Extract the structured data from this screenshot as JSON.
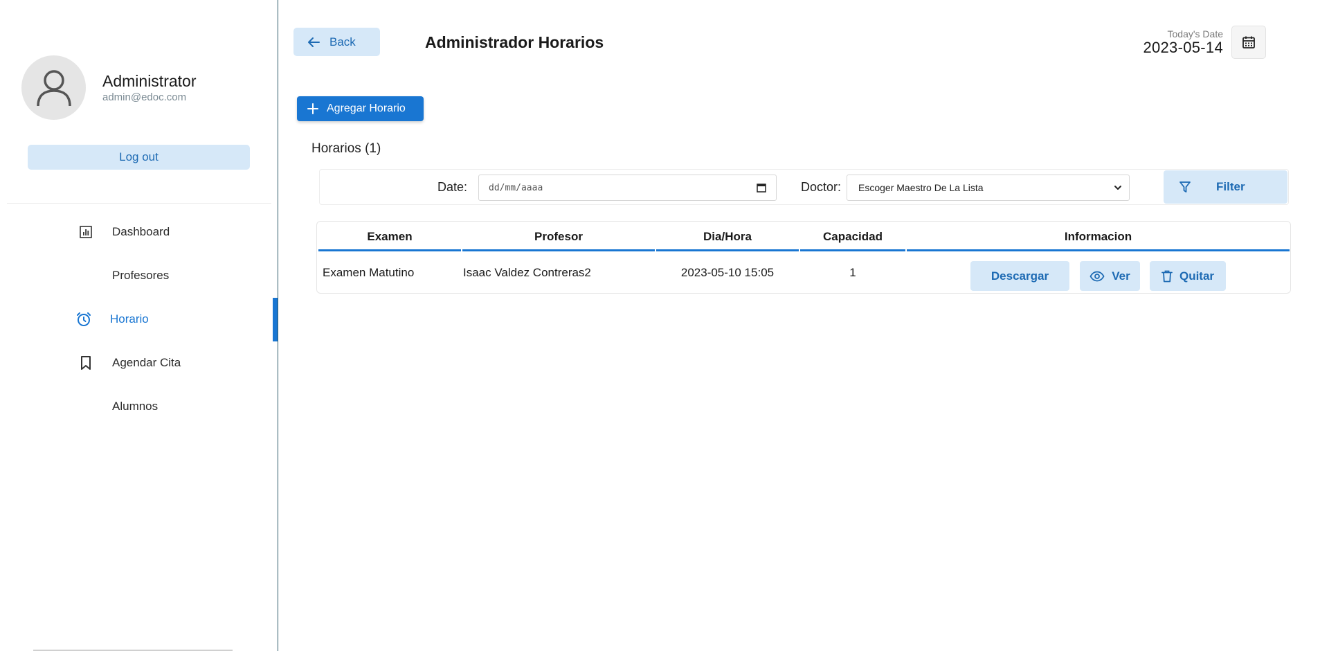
{
  "profile": {
    "name": "Administrator",
    "email": "admin@edoc.com",
    "logout_label": "Log out"
  },
  "sidebar": {
    "items": [
      {
        "label": "Dashboard",
        "icon": "dashboard-icon",
        "active": false
      },
      {
        "label": "Profesores",
        "icon": "",
        "active": false
      },
      {
        "label": "Horario",
        "icon": "alarm-clock-icon",
        "active": true
      },
      {
        "label": "Agendar Cita",
        "icon": "bookmark-icon",
        "active": false
      },
      {
        "label": "Alumnos",
        "icon": "",
        "active": false
      }
    ]
  },
  "header": {
    "back_label": "Back",
    "title": "Administrador Horarios",
    "today_label": "Today's Date",
    "today_value": "2023-05-14"
  },
  "actions": {
    "add_label": "Agregar Horario"
  },
  "section": {
    "title": "Horarios (1)"
  },
  "filter": {
    "date_label": "Date:",
    "date_placeholder": "dd/mm/aaaa",
    "doctor_label": "Doctor:",
    "doctor_selected": "Escoger Maestro De La Lista",
    "filter_label": "Filter"
  },
  "table": {
    "headers": [
      "Examen",
      "Profesor",
      "Dia/Hora",
      "Capacidad",
      "Informacion"
    ],
    "rows": [
      {
        "examen": "Examen Matutino",
        "profesor": "Isaac Valdez Contreras2",
        "dia_hora": "2023-05-10 15:05",
        "capacidad": "1",
        "buttons": {
          "download": "Descargar",
          "view": "Ver",
          "remove": "Quitar"
        }
      }
    ]
  },
  "colors": {
    "accent": "#1976d2",
    "accent_light": "#d6e8f8",
    "accent_text": "#1d6ab3"
  }
}
